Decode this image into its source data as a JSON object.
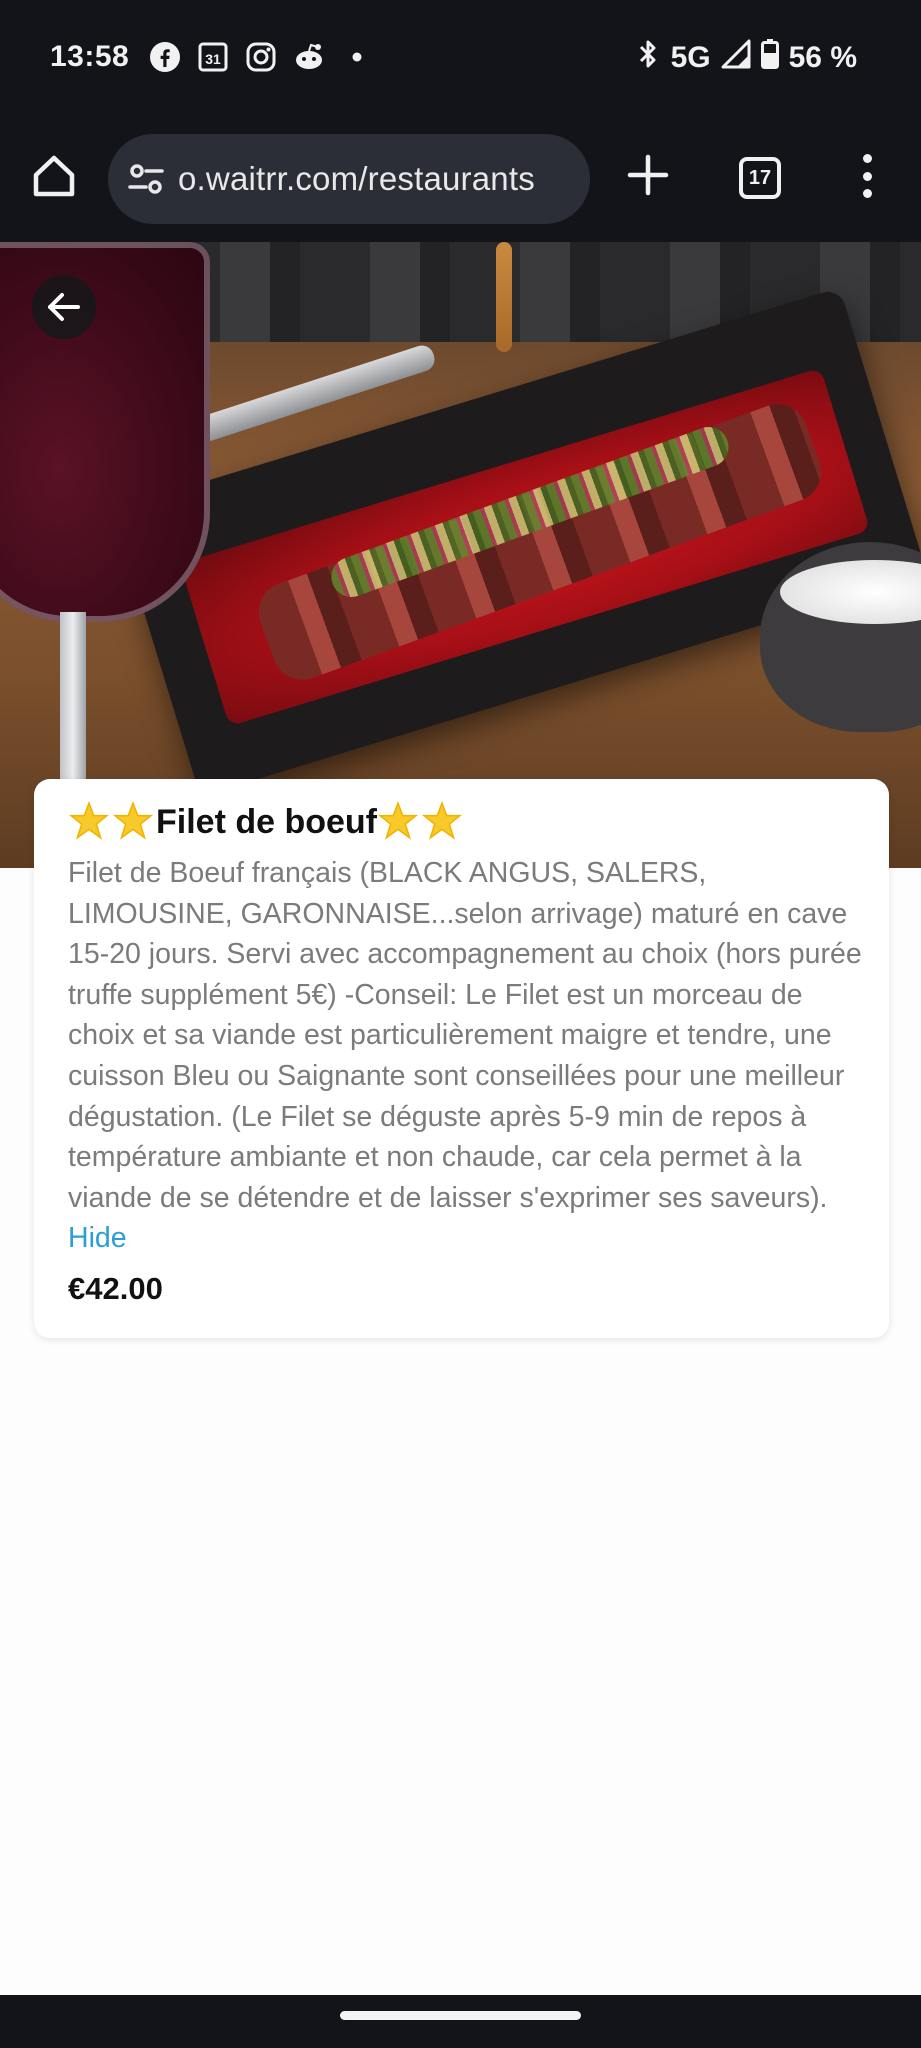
{
  "status_bar": {
    "time": "13:58",
    "left_icons": [
      "facebook-icon",
      "calendar-icon",
      "instagram-icon",
      "reddit-icon",
      "dot-icon"
    ],
    "calendar_day": "31",
    "network": "5G",
    "battery": "56 %"
  },
  "browser": {
    "url": "o.waitrr.com/restaurants",
    "tab_count": "17"
  },
  "item": {
    "title_prefix_stars": 2,
    "title": "Filet de boeuf",
    "title_suffix_stars": 2,
    "description": "Filet de Boeuf français (BLACK ANGUS, SALERS, LIMOUSINE, GARONNAISE...selon arrivage) maturé en cave 15-20 jours. Servi avec accompagnement au choix (hors purée truffe supplément 5€) -Conseil: Le Filet est un morceau de choix et sa viande est particulièrement maigre et tendre, une cuisson Bleu ou Saignante sont conseillées pour une meilleur dégustation. (Le Filet se déguste après 5-9 min de repos à température ambiante et non chaude, car cela permet à la viande de se détendre et de laisser s'exprimer ses saveurs).",
    "hide_label": "Hide",
    "price": "€42.00"
  },
  "colors": {
    "link": "#2a9fd6",
    "chrome_bg": "#12141a",
    "description_text": "#7b7b7b"
  }
}
